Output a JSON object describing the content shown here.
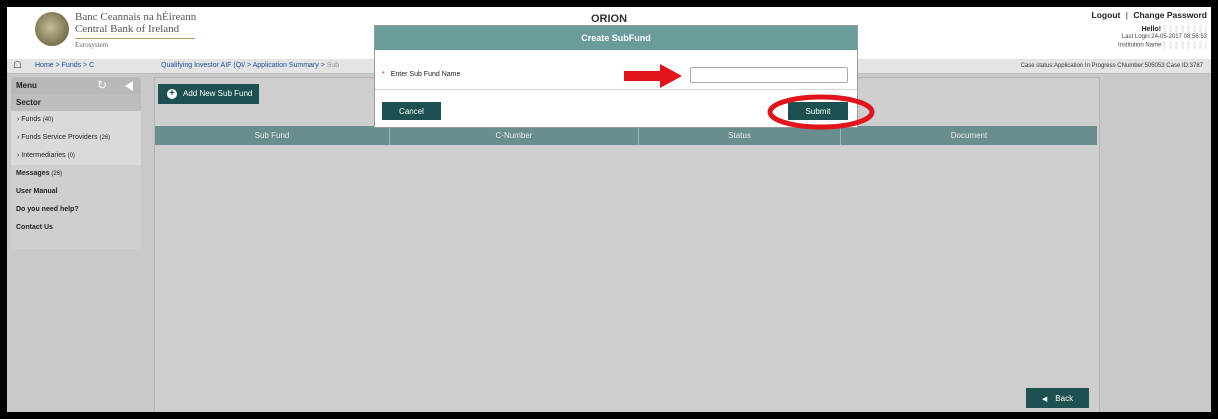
{
  "header": {
    "bank_name_irish": "Banc Ceannais na hÉireann",
    "bank_name_english": "Central Bank of Ireland",
    "eurosystem": "Eurosystem",
    "app_title": "ORION",
    "logout": "Logout",
    "separator": "|",
    "change_password": "Change Password",
    "hello": "Hello!",
    "last_login": "Last Login:24-05-2017 08:56:53",
    "institution_name": "Institution Name"
  },
  "breadcrumb": {
    "part1": "Home >  Funds >  C",
    "part2": "Qualifying Investor AIF (QI/ >   Application Summary >",
    "part2_faded": "Sub",
    "case_status": "Case status:Application In Progress    CNumber:505053    Case ID:3787"
  },
  "sidebar": {
    "menu_label": "Menu",
    "sector_label": "Sector",
    "items": [
      {
        "label": "Funds",
        "count": "(40)"
      },
      {
        "label": "Funds Service Providers",
        "count": "(26)"
      },
      {
        "label": "Intermediaries",
        "count": "(0)"
      }
    ],
    "links": [
      {
        "label": "Messages",
        "count": "(26)"
      },
      {
        "label": "User Manual",
        "count": ""
      },
      {
        "label": "Do you need help?",
        "count": ""
      },
      {
        "label": "Contact Us",
        "count": ""
      }
    ]
  },
  "main": {
    "add_button": "Add New Sub Fund",
    "columns": [
      "Sub Fund",
      "C-Number",
      "Status",
      "Document"
    ],
    "back_button": "Back"
  },
  "modal": {
    "title": "Create SubFund",
    "required_mark": "*",
    "field_label": "Enter Sub Fund Name",
    "field_value": "",
    "cancel_label": "Cancel",
    "submit_label": "Submit"
  },
  "colors": {
    "button": "#1d5050",
    "modal_header": "#6a9c9c",
    "table_header": "#6a8d8d",
    "annotation": "#e0141a"
  },
  "icons": [
    "home-icon",
    "refresh-icon",
    "collapse-icon",
    "plus-icon",
    "back-arrow-icon",
    "arrow-annotation",
    "circle-annotation"
  ]
}
